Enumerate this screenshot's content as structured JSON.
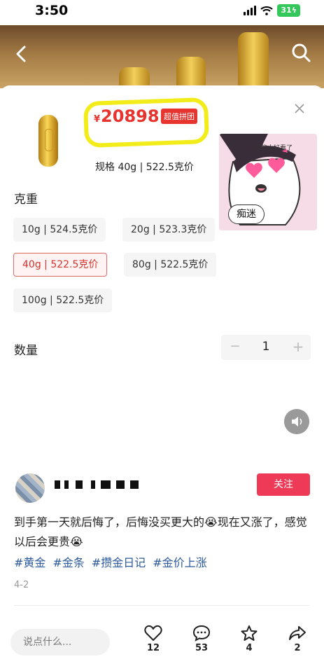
{
  "status_bar": {
    "time": "3:50",
    "battery": "31"
  },
  "sheet": {
    "price_currency": "¥",
    "price_value": "20898",
    "price_badge": "超值拼团",
    "spec_line": "规格 40g | 522.5克价",
    "sticker_text": "真的太好看了",
    "sticker_bubble": "痴迷",
    "weight_label": "克重",
    "weight_options": [
      "10g | 524.5克价",
      "20g | 523.3克价",
      "40g | 522.5克价",
      "80g | 522.5克价",
      "100g | 522.5克价"
    ],
    "selected_option": "40g | 522.5克价",
    "quantity_label": "数量",
    "quantity_minus": "−",
    "quantity_value": "1",
    "quantity_plus": "+"
  },
  "post": {
    "follow_label": "关注",
    "body": "到手第一天就后悔了，后悔没买更大的😭现在又涨了，感觉以后会更贵😭",
    "hashtags": [
      "#黄金",
      "#金条",
      "#攒金日记",
      "#金价上涨"
    ],
    "date": "4-2",
    "comment_placeholder": "说点什么...",
    "likes": "12",
    "comments": "53",
    "favorites": "4",
    "shares": "2"
  },
  "colors": {
    "accent_red": "#e8342e",
    "follow_pink": "#ee3a57",
    "hashtag_blue": "#2d5a9a",
    "highlight_yellow": "#f2ec1a"
  }
}
